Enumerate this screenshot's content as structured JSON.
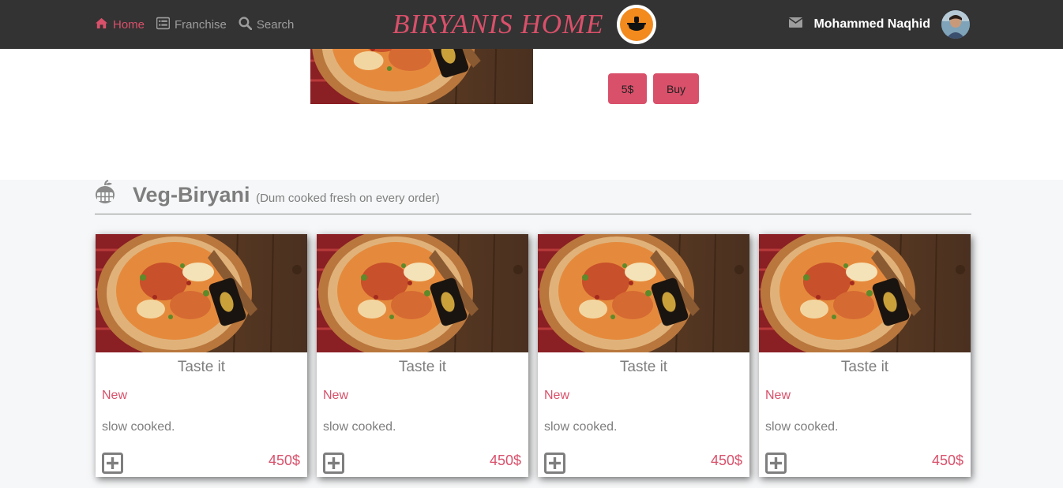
{
  "nav": {
    "home": "Home",
    "franchise": "Franchise",
    "search": "Search",
    "brand": "BIRYANIS HOME",
    "user_name": "Mohammed Naqhid"
  },
  "featured": {
    "price_button": "5$",
    "buy_button": "Buy"
  },
  "section": {
    "title": "Veg-Biryani",
    "subtitle": "(Dum cooked fresh on every order)"
  },
  "cards": [
    {
      "title": "Taste it",
      "tag": "New",
      "desc": "slow cooked.",
      "price": "450$"
    },
    {
      "title": "Taste it",
      "tag": "New",
      "desc": "slow cooked.",
      "price": "450$"
    },
    {
      "title": "Taste it",
      "tag": "New",
      "desc": "slow cooked.",
      "price": "450$"
    },
    {
      "title": "Taste it",
      "tag": "New",
      "desc": "slow cooked.",
      "price": "450$"
    }
  ],
  "colors": {
    "navbar": "#333333",
    "accent": "#d9506a",
    "muted_text": "#7e7e7e",
    "page_bg": "#f6f7f8"
  }
}
